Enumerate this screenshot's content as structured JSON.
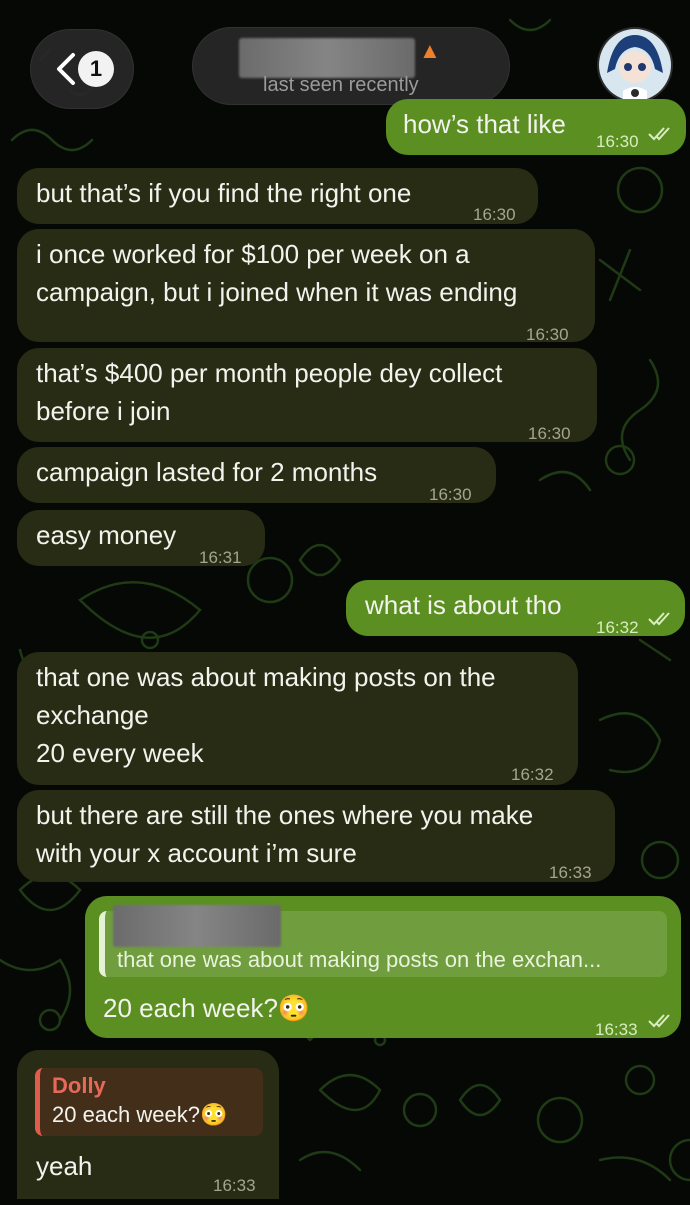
{
  "header": {
    "unread_count": "1",
    "status": "last seen recently"
  },
  "messages": [
    {
      "text": "how’s that like",
      "time": "16:30"
    },
    {
      "text": "but that’s if you find the right one",
      "time": "16:30"
    },
    {
      "text": "i once worked for $100 per week on a\ncampaign, but i joined when it was ending",
      "time": "16:30"
    },
    {
      "text": "that’s $400 per month people dey collect\nbefore i join",
      "time": "16:30"
    },
    {
      "text": "campaign lasted for 2 months",
      "time": "16:30"
    },
    {
      "text": "easy money",
      "time": "16:31"
    },
    {
      "text": "what is about tho",
      "time": "16:32"
    },
    {
      "text": "that one was about making posts on the\nexchange\n20 every week",
      "time": "16:32"
    },
    {
      "text": "but there are still the ones where you make\nwith your x account i’m sure",
      "time": "16:33"
    },
    {
      "text": "20 each week?😳",
      "time": "16:33",
      "reply": {
        "text": "that one was about making posts on the exchan..."
      }
    },
    {
      "text": "yeah",
      "time": "16:33",
      "reply": {
        "name": "Dolly",
        "text": "20 each week?😳"
      }
    }
  ],
  "colors": {
    "incoming": "#292c15",
    "outgoing": "#5b8f22",
    "doodle": "#1d3a12",
    "reply_name": "#e8695a"
  }
}
